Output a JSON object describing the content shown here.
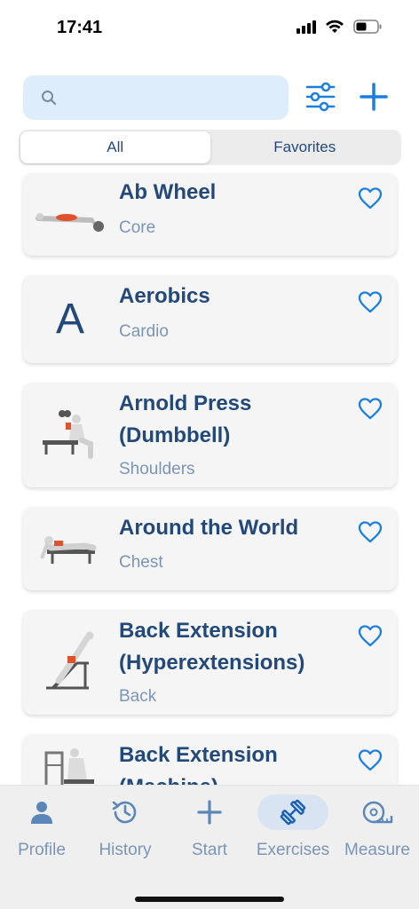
{
  "status_bar": {
    "time": "17:41"
  },
  "search": {
    "placeholder": ""
  },
  "segments": [
    {
      "label": "All",
      "active": true
    },
    {
      "label": "Favorites",
      "active": false
    }
  ],
  "exercises": [
    {
      "name": "Ab Wheel",
      "category": "Core",
      "thumb": "ab-wheel-figure"
    },
    {
      "name": "Aerobics",
      "category": "Cardio",
      "thumb_letter": "A"
    },
    {
      "name": "Arnold Press (Dumbbell)",
      "category": "Shoulders",
      "thumb": "arnold-press-figure"
    },
    {
      "name": "Around the World",
      "category": "Chest",
      "thumb": "around-the-world-figure"
    },
    {
      "name": "Back Extension (Hyperextensions)",
      "category": "Back",
      "thumb": "back-extension-figure"
    },
    {
      "name": "Back Extension (Machine)",
      "category": "",
      "thumb": "back-extension-machine-figure"
    }
  ],
  "tabs": [
    {
      "label": "Profile",
      "icon": "person-icon",
      "active": false
    },
    {
      "label": "History",
      "icon": "history-icon",
      "active": false
    },
    {
      "label": "Start",
      "icon": "plus-icon",
      "active": false
    },
    {
      "label": "Exercises",
      "icon": "dumbbell-icon",
      "active": true
    },
    {
      "label": "Measure",
      "icon": "tape-measure-icon",
      "active": false
    }
  ],
  "colors": {
    "accent": "#1a7fe0",
    "text": "#22497a",
    "muted": "#7b95b5",
    "search_bg": "#deedfb"
  }
}
